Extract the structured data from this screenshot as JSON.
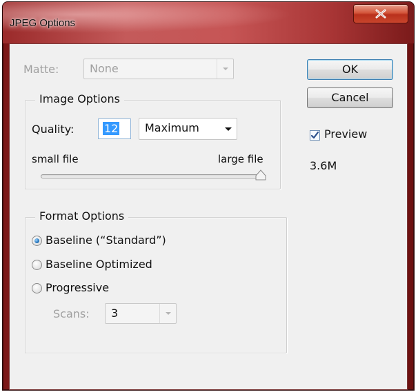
{
  "window": {
    "title": "JPEG Options",
    "close_glyph": "X"
  },
  "matte": {
    "label": "Matte:",
    "value": "None",
    "enabled": false
  },
  "image_options": {
    "group_title": "Image Options",
    "quality_label": "Quality:",
    "quality_value": "12",
    "quality_preset": "Maximum",
    "slider_min_label": "small file",
    "slider_max_label": "large file",
    "slider_level": 1.0
  },
  "format_options": {
    "group_title": "Format Options",
    "options": [
      {
        "label": "Baseline (“Standard”)",
        "selected": true
      },
      {
        "label": "Baseline Optimized",
        "selected": false
      },
      {
        "label": "Progressive",
        "selected": false
      }
    ],
    "scans_label": "Scans:",
    "scans_value": "3"
  },
  "buttons": {
    "ok": "OK",
    "cancel": "Cancel"
  },
  "preview": {
    "label": "Preview",
    "checked": true,
    "file_size": "3.6M"
  },
  "icons": {
    "close": "close-icon",
    "dropdown": "chevron-down-icon",
    "checkmark": "checkmark-icon",
    "slider_thumb": "slider-thumb-icon"
  },
  "colors": {
    "title_bar": "#b33a3a",
    "focus_highlight": "#cde8ff",
    "radio_dot": "#2a7ac0"
  }
}
